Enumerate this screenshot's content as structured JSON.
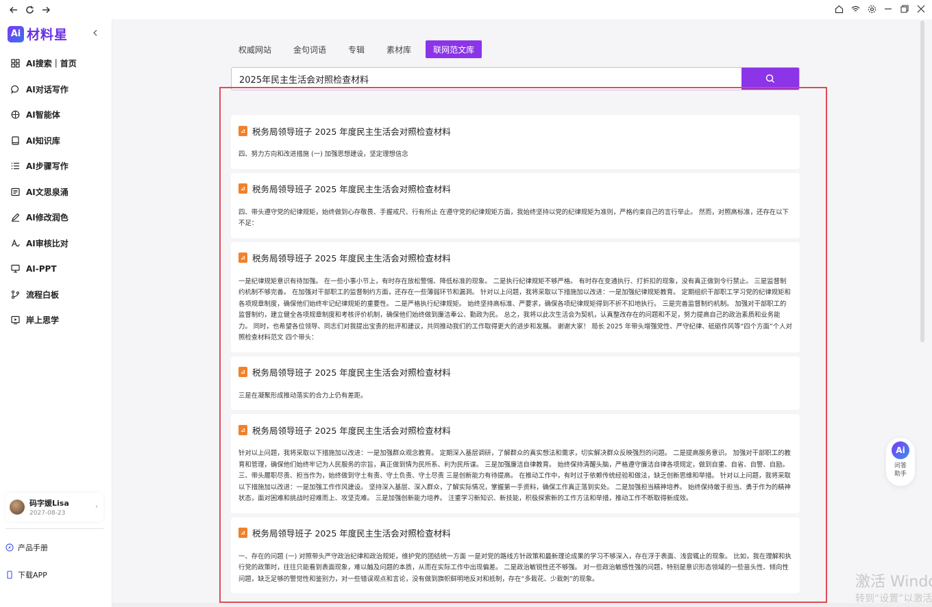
{
  "app": {
    "brand_name": "材料星",
    "brand_logo_text": "Ai"
  },
  "sidebar": {
    "items": [
      {
        "label": "AI搜索｜首页",
        "icon": "grid-icon"
      },
      {
        "label": "AI对话写作",
        "icon": "chat-bubble-icon"
      },
      {
        "label": "AI智能体",
        "icon": "globe-icon"
      },
      {
        "label": "AI知识库",
        "icon": "book-icon"
      },
      {
        "label": "AI步骤写作",
        "icon": "list-icon"
      },
      {
        "label": "AI文思泉涌",
        "icon": "document-icon"
      },
      {
        "label": "AI修改润色",
        "icon": "pen-icon"
      },
      {
        "label": "AI审核比对",
        "icon": "text-check-icon"
      },
      {
        "label": "AI-PPT",
        "icon": "monitor-icon"
      },
      {
        "label": "流程白板",
        "icon": "flow-icon"
      },
      {
        "label": "岸上思学",
        "icon": "play-screen-icon"
      }
    ],
    "user": {
      "name": "码字媛Lisa",
      "date": "2027-08-23"
    },
    "footer": {
      "manual": "产品手册",
      "download": "下载APP"
    }
  },
  "tabs": [
    {
      "label": "权威网站",
      "active": false
    },
    {
      "label": "金句词语",
      "active": false
    },
    {
      "label": "专辑",
      "active": false
    },
    {
      "label": "素材库",
      "active": false
    },
    {
      "label": "联网范文库",
      "active": true
    }
  ],
  "search": {
    "value": "2025年民主生活会对照检查材料"
  },
  "results": [
    {
      "title": "税务局领导班子 2025 年度民主生活会对照检查材料",
      "snippet": "四、努力方向和改进措施 (一) 加强思想建设，坚定理想信念"
    },
    {
      "title": "税务局领导班子 2025 年度民主生活会对照检查材料",
      "snippet": "四、带头遵守党的纪律规矩，始终做到心存敬畏、手握戒尺、行有所止 在遵守党的纪律规矩方面，我始终坚持以党的纪律规矩为准则，严格约束自己的言行举止。 然而，对照高标准，还存在以下不足："
    },
    {
      "title": "税务局领导班子 2025 年度民主生活会对照检查材料",
      "snippet": "一是纪律规矩意识有待加强。 在一些小事小节上，有时存在放松警惕、降低标准的现象。 二是执行纪律规矩不够严格。 有时存在变通执行、打折扣的现象，没有真正做到令行禁止。 三是监督制约机制不够完善。 在加强对干部职工的监督制约方面，还存在一些薄弱环节和漏洞。 针对以上问题，我将采取以下措施加以改进：一是加强纪律规矩教育。 定期组织干部职工学习党的纪律规矩和各项规章制度，确保他们始终牢记纪律规矩的重要性。 二是严格执行纪律规矩。 始终坚持高标准、严要求，确保各项纪律规矩得到不折不扣地执行。 三是完善监督制约机制。 加强对干部职工的监督制约，建立健全各项规章制度和考核评价机制，确保他们始终做到廉洁奉公、勤政为民。 总之，我将以此次生活会为契机，认真整改存在的问题和不足，努力提高自己的政治素质和业务能力。 同时，也希望各位领导、同志们对我提出宝贵的批评和建议，共同推动我们的工作取得更大的进步和发展。 谢谢大家！ 局长 2025 年带头增强党性、严守纪律、砥砺作风等“四个方面”个人对照检查材料范文 四个带头："
    },
    {
      "title": "税务局领导班子 2025 年度民主生活会对照检查材料",
      "snippet": "三是在凝聚形成推动落实的合力上仍有差距。"
    },
    {
      "title": "税务局领导班子 2025 年度民主生活会对照检查材料",
      "snippet": "针对以上问题，我将采取以下措施加以改进：一是加强群众观念教育。 定期深入基层调研，了解群众的真实想法和需求，切实解决群众反映强烈的问题。 二是提高服务意识。 加强对干部职工的教育和管理，确保他们始终牢记为人民服务的宗旨，真正做到情为民所系、利为民所谋。 三是加强廉洁自律教育。 始终保持清醒头脑，严格遵守廉洁自律各项规定，做到自重、自省、自警、自励。 三、带头履职尽责、担当作为，始终做到守土有责、守土负责、守土尽责 三是创新能力有待提高。 在推动工作中，有时过于依赖传统经验和做法，缺乏创新思维和举措。 针对以上问题，我将采取以下措施加以改进：一是加强工作作风建设。 坚持深入基层、深入群众，了解实际情况，掌握第一手资料，确保工作真正落到实处。 二是加强担当精神培养。 始终保持敢于担当、勇于作为的精神状态，面对困难和挑战时迎难而上、攻坚克难。 三是加强创新能力培养。 注重学习新知识、新技能，积极探索新的工作方法和举措，推动工作不断取得新成效。"
    },
    {
      "title": "税务局领导班子 2025 年度民主生活会对照检查材料",
      "snippet": "一、存在的问题 (一) 对照带头严守政治纪律和政治规矩，维护党的团结统一方面 一是对党的路线方针政策和最新理论成果的学习不够深入，存在浮于表面、浅尝辄止的现象。 比如，我在理解和执行党的政策时，往往只能看到表面现象，难以触及问题的本质，从而在实际工作中出现偏差。 二是政治敏锐性还不够强。 对一些政治敏感性强的问题，特别是意识形态领域的一些苗头性、倾向性问题，缺乏足够的警觉性和鉴别力，对一些错误观点和言论，没有做到旗帜鲜明地反对和抵制，存在“多栽花、少栽刺”的现象。"
    }
  ],
  "helper": {
    "logo_text": "Ai",
    "label_line1": "问答",
    "label_line2": "助手"
  },
  "watermark": {
    "line1": "激活 Windows",
    "line2": "转到“设置”以激活 Windows。"
  }
}
